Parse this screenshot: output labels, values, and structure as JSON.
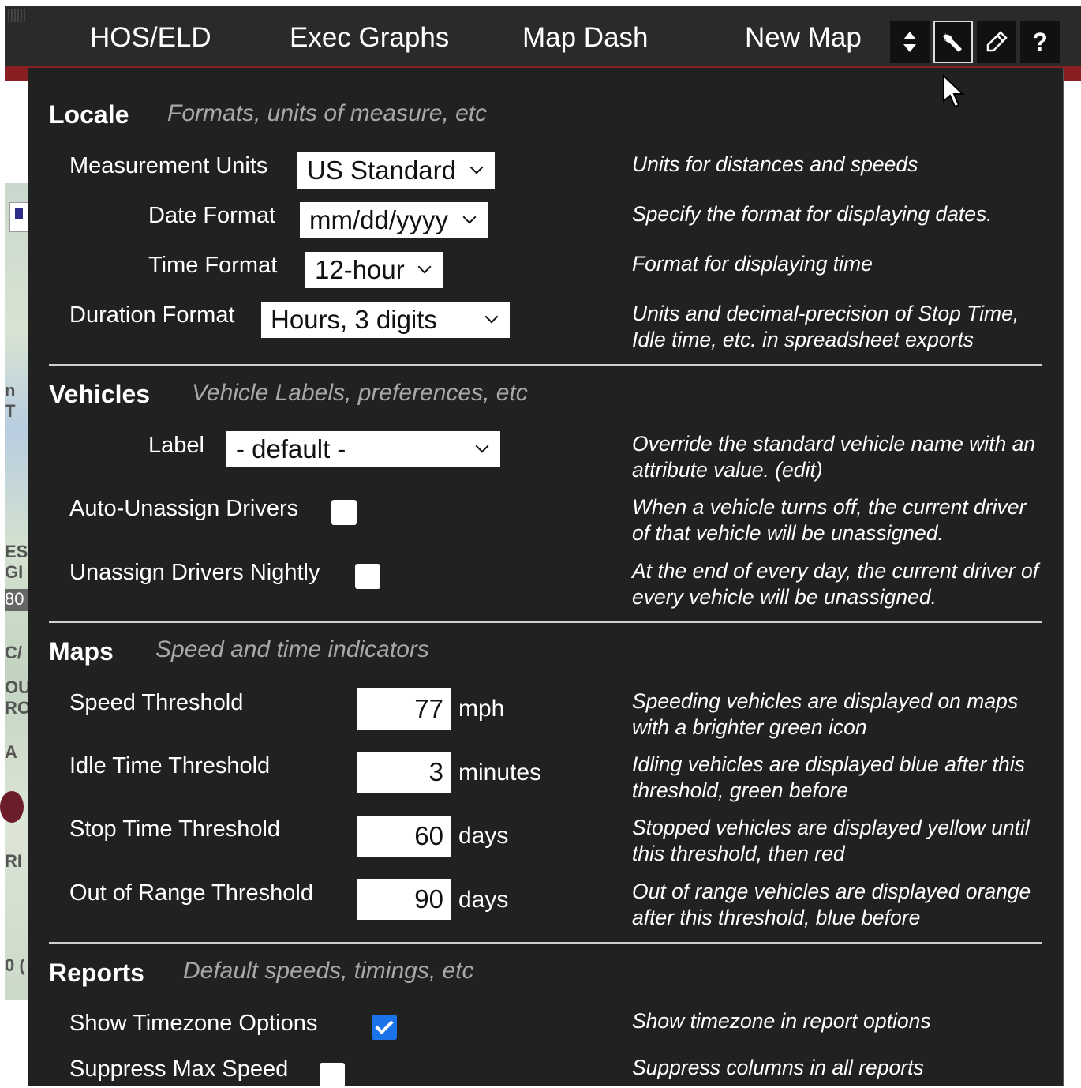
{
  "nav": {
    "items": [
      "HOS/ELD",
      "Exec Graphs",
      "Map Dash",
      "New Map"
    ],
    "icons": [
      {
        "name": "sort-arrows-icon",
        "glyph": "⬍",
        "active": false
      },
      {
        "name": "wrench-icon",
        "glyph": "🔧",
        "active": true
      },
      {
        "name": "eraser-icon",
        "glyph": "✎",
        "active": false
      },
      {
        "name": "help-icon",
        "glyph": "?",
        "active": false
      }
    ]
  },
  "map_fragments": [
    "ES",
    "GI",
    "80",
    "C/",
    "OU",
    "RO",
    "A",
    "RI",
    "0 (",
    "n T"
  ],
  "locale": {
    "title": "Locale",
    "subtitle": "Formats, units of measure, etc",
    "measurement_units": {
      "label": "Measurement Units",
      "value": "US Standard",
      "desc": "Units for distances and speeds"
    },
    "date_format": {
      "label": "Date Format",
      "value": "mm/dd/yyyy",
      "desc": "Specify the format for displaying dates."
    },
    "time_format": {
      "label": "Time Format",
      "value": "12-hour",
      "desc": "Format for displaying time"
    },
    "duration_format": {
      "label": "Duration Format",
      "value": "Hours, 3 digits",
      "desc": "Units and decimal-precision of Stop Time, Idle time, etc. in spreadsheet exports"
    }
  },
  "vehicles": {
    "title": "Vehicles",
    "subtitle": "Vehicle Labels, preferences, etc",
    "label": {
      "label": "Label",
      "value": "- default -",
      "desc": "Override the standard vehicle name with an attribute value. (edit)"
    },
    "auto_unassign": {
      "label": "Auto-Unassign Drivers",
      "checked": false,
      "desc": "When a vehicle turns off, the current driver of that vehicle will be unassigned."
    },
    "unassign_nightly": {
      "label": "Unassign Drivers Nightly",
      "checked": false,
      "desc": "At the end of every day, the current driver of every vehicle will be unassigned."
    }
  },
  "maps": {
    "title": "Maps",
    "subtitle": "Speed and time indicators",
    "speed": {
      "label": "Speed Threshold",
      "value": "77",
      "unit": "mph",
      "desc": "Speeding vehicles are displayed on maps with a brighter green icon"
    },
    "idle": {
      "label": "Idle Time Threshold",
      "value": "3",
      "unit": "minutes",
      "desc": "Idling vehicles are displayed blue after this threshold, green before"
    },
    "stop": {
      "label": "Stop Time Threshold",
      "value": "60",
      "unit": "days",
      "desc": "Stopped vehicles are displayed yellow until this threshold, then red"
    },
    "out_of_range": {
      "label": "Out of Range Threshold",
      "value": "90",
      "unit": "days",
      "desc": "Out of range vehicles are displayed orange after this threshold, blue before"
    }
  },
  "reports": {
    "title": "Reports",
    "subtitle": "Default speeds, timings, etc",
    "show_timezone": {
      "label": "Show Timezone Options",
      "checked": true,
      "desc": "Show timezone in report options"
    },
    "suppress_max_speed": {
      "label": "Suppress Max Speed",
      "checked": false,
      "desc": "Suppress columns in all reports"
    }
  },
  "colors": {
    "topbar": "#2a2a2a",
    "panel": "#212121",
    "accent": "#8a1f22",
    "checkbox_checked": "#1a73e8"
  }
}
